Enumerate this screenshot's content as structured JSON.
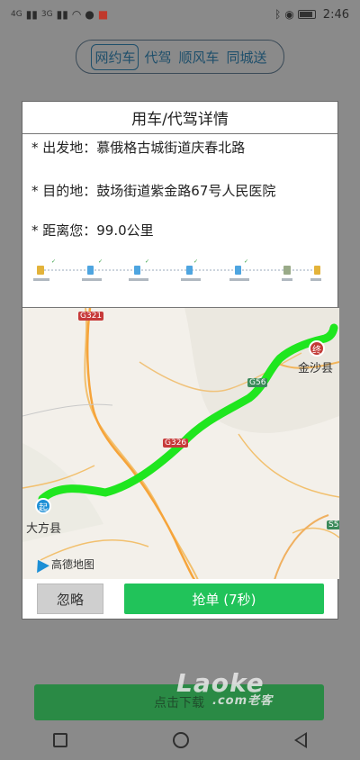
{
  "status_bar": {
    "signal_left": "4G",
    "signal_right": "3G",
    "time": "2:46"
  },
  "tabs": [
    {
      "label": "网约车",
      "active": true
    },
    {
      "label": "代驾",
      "active": false
    },
    {
      "label": "顺风车",
      "active": false
    },
    {
      "label": "同城送",
      "active": false
    }
  ],
  "dialog": {
    "title": "用车/代驾详情",
    "departure": "* 出发地：慕俄格古城街道庆春北路",
    "destination": "* 目的地：鼓场街道紫金路67号人民医院",
    "distance": "* 距离您：99.0公里",
    "map": {
      "start_pin": "起",
      "end_pin": "终",
      "start_city": "大方县",
      "end_city": "金沙县",
      "roads": [
        "G321",
        "G56",
        "G326",
        "S5"
      ],
      "logo": "高德地图",
      "route_color": "#1fe61f"
    },
    "ignore_button": "忽略",
    "grab_button": "抢单 (7秒)"
  },
  "background": {
    "bottom_button": "点击下载",
    "watermark": "Laoke",
    "watermark_sub": ".com老客"
  }
}
